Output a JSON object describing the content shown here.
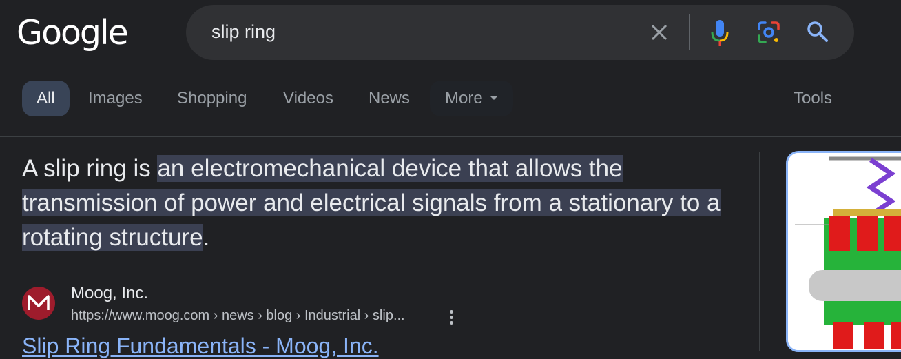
{
  "header": {
    "logo_text": "Google",
    "search": {
      "query": "slip ring"
    }
  },
  "tabs": {
    "all": "All",
    "images": "Images",
    "shopping": "Shopping",
    "videos": "Videos",
    "news": "News",
    "more": "More",
    "tools": "Tools"
  },
  "answer": {
    "prefix": "A slip ring is ",
    "highlight": "an electromechanical device that allows the transmission of power and electrical signals from a stationary to a rotating structure",
    "suffix": "."
  },
  "source": {
    "name": "Moog, Inc.",
    "url": "https://www.moog.com › news › blog › Industrial › slip...",
    "title": "Slip Ring Fundamentals - Moog, Inc."
  },
  "colors": {
    "background": "#202124",
    "link": "#8ab4f8",
    "active_tab": "#394457",
    "highlight": "#3b4052"
  }
}
